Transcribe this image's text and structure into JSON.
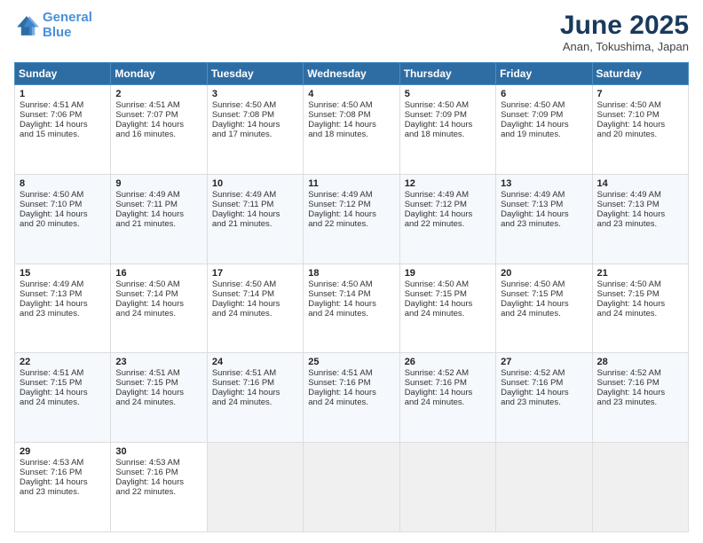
{
  "logo": {
    "line1": "General",
    "line2": "Blue"
  },
  "title": "June 2025",
  "subtitle": "Anan, Tokushima, Japan",
  "days_of_week": [
    "Sunday",
    "Monday",
    "Tuesday",
    "Wednesday",
    "Thursday",
    "Friday",
    "Saturday"
  ],
  "weeks": [
    [
      {
        "day": "1",
        "sunrise": "Sunrise: 4:51 AM",
        "sunset": "Sunset: 7:06 PM",
        "daylight": "Daylight: 14 hours and 15 minutes."
      },
      {
        "day": "2",
        "sunrise": "Sunrise: 4:51 AM",
        "sunset": "Sunset: 7:07 PM",
        "daylight": "Daylight: 14 hours and 16 minutes."
      },
      {
        "day": "3",
        "sunrise": "Sunrise: 4:50 AM",
        "sunset": "Sunset: 7:08 PM",
        "daylight": "Daylight: 14 hours and 17 minutes."
      },
      {
        "day": "4",
        "sunrise": "Sunrise: 4:50 AM",
        "sunset": "Sunset: 7:08 PM",
        "daylight": "Daylight: 14 hours and 18 minutes."
      },
      {
        "day": "5",
        "sunrise": "Sunrise: 4:50 AM",
        "sunset": "Sunset: 7:09 PM",
        "daylight": "Daylight: 14 hours and 18 minutes."
      },
      {
        "day": "6",
        "sunrise": "Sunrise: 4:50 AM",
        "sunset": "Sunset: 7:09 PM",
        "daylight": "Daylight: 14 hours and 19 minutes."
      },
      {
        "day": "7",
        "sunrise": "Sunrise: 4:50 AM",
        "sunset": "Sunset: 7:10 PM",
        "daylight": "Daylight: 14 hours and 20 minutes."
      }
    ],
    [
      {
        "day": "8",
        "sunrise": "Sunrise: 4:50 AM",
        "sunset": "Sunset: 7:10 PM",
        "daylight": "Daylight: 14 hours and 20 minutes."
      },
      {
        "day": "9",
        "sunrise": "Sunrise: 4:49 AM",
        "sunset": "Sunset: 7:11 PM",
        "daylight": "Daylight: 14 hours and 21 minutes."
      },
      {
        "day": "10",
        "sunrise": "Sunrise: 4:49 AM",
        "sunset": "Sunset: 7:11 PM",
        "daylight": "Daylight: 14 hours and 21 minutes."
      },
      {
        "day": "11",
        "sunrise": "Sunrise: 4:49 AM",
        "sunset": "Sunset: 7:12 PM",
        "daylight": "Daylight: 14 hours and 22 minutes."
      },
      {
        "day": "12",
        "sunrise": "Sunrise: 4:49 AM",
        "sunset": "Sunset: 7:12 PM",
        "daylight": "Daylight: 14 hours and 22 minutes."
      },
      {
        "day": "13",
        "sunrise": "Sunrise: 4:49 AM",
        "sunset": "Sunset: 7:13 PM",
        "daylight": "Daylight: 14 hours and 23 minutes."
      },
      {
        "day": "14",
        "sunrise": "Sunrise: 4:49 AM",
        "sunset": "Sunset: 7:13 PM",
        "daylight": "Daylight: 14 hours and 23 minutes."
      }
    ],
    [
      {
        "day": "15",
        "sunrise": "Sunrise: 4:49 AM",
        "sunset": "Sunset: 7:13 PM",
        "daylight": "Daylight: 14 hours and 23 minutes."
      },
      {
        "day": "16",
        "sunrise": "Sunrise: 4:50 AM",
        "sunset": "Sunset: 7:14 PM",
        "daylight": "Daylight: 14 hours and 24 minutes."
      },
      {
        "day": "17",
        "sunrise": "Sunrise: 4:50 AM",
        "sunset": "Sunset: 7:14 PM",
        "daylight": "Daylight: 14 hours and 24 minutes."
      },
      {
        "day": "18",
        "sunrise": "Sunrise: 4:50 AM",
        "sunset": "Sunset: 7:14 PM",
        "daylight": "Daylight: 14 hours and 24 minutes."
      },
      {
        "day": "19",
        "sunrise": "Sunrise: 4:50 AM",
        "sunset": "Sunset: 7:15 PM",
        "daylight": "Daylight: 14 hours and 24 minutes."
      },
      {
        "day": "20",
        "sunrise": "Sunrise: 4:50 AM",
        "sunset": "Sunset: 7:15 PM",
        "daylight": "Daylight: 14 hours and 24 minutes."
      },
      {
        "day": "21",
        "sunrise": "Sunrise: 4:50 AM",
        "sunset": "Sunset: 7:15 PM",
        "daylight": "Daylight: 14 hours and 24 minutes."
      }
    ],
    [
      {
        "day": "22",
        "sunrise": "Sunrise: 4:51 AM",
        "sunset": "Sunset: 7:15 PM",
        "daylight": "Daylight: 14 hours and 24 minutes."
      },
      {
        "day": "23",
        "sunrise": "Sunrise: 4:51 AM",
        "sunset": "Sunset: 7:15 PM",
        "daylight": "Daylight: 14 hours and 24 minutes."
      },
      {
        "day": "24",
        "sunrise": "Sunrise: 4:51 AM",
        "sunset": "Sunset: 7:16 PM",
        "daylight": "Daylight: 14 hours and 24 minutes."
      },
      {
        "day": "25",
        "sunrise": "Sunrise: 4:51 AM",
        "sunset": "Sunset: 7:16 PM",
        "daylight": "Daylight: 14 hours and 24 minutes."
      },
      {
        "day": "26",
        "sunrise": "Sunrise: 4:52 AM",
        "sunset": "Sunset: 7:16 PM",
        "daylight": "Daylight: 14 hours and 24 minutes."
      },
      {
        "day": "27",
        "sunrise": "Sunrise: 4:52 AM",
        "sunset": "Sunset: 7:16 PM",
        "daylight": "Daylight: 14 hours and 23 minutes."
      },
      {
        "day": "28",
        "sunrise": "Sunrise: 4:52 AM",
        "sunset": "Sunset: 7:16 PM",
        "daylight": "Daylight: 14 hours and 23 minutes."
      }
    ],
    [
      {
        "day": "29",
        "sunrise": "Sunrise: 4:53 AM",
        "sunset": "Sunset: 7:16 PM",
        "daylight": "Daylight: 14 hours and 23 minutes."
      },
      {
        "day": "30",
        "sunrise": "Sunrise: 4:53 AM",
        "sunset": "Sunset: 7:16 PM",
        "daylight": "Daylight: 14 hours and 22 minutes."
      },
      null,
      null,
      null,
      null,
      null
    ]
  ]
}
